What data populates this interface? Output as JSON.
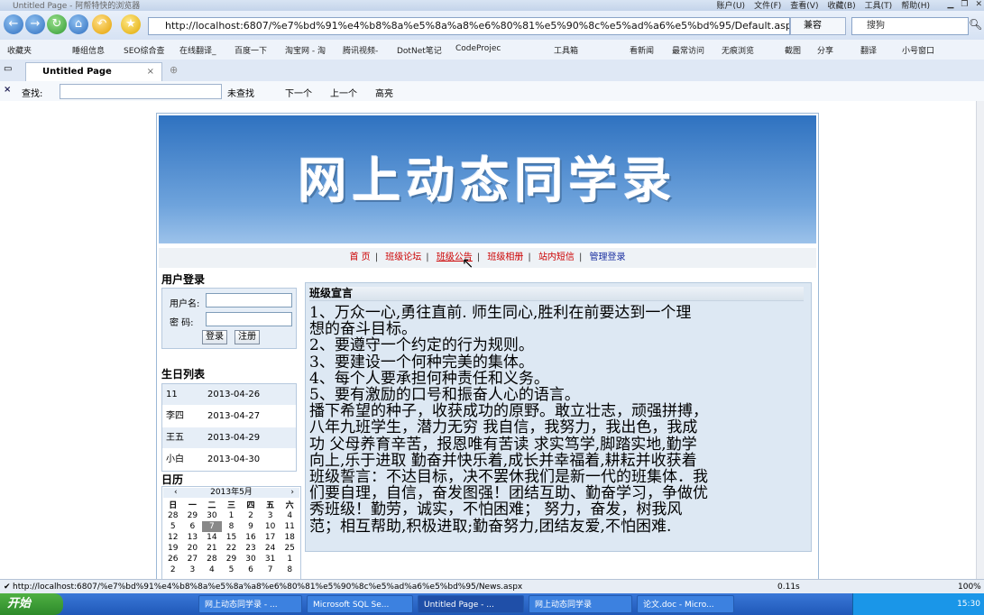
{
  "window": {
    "title": "Untitled Page - 阿帮特快的浏览器",
    "menu": [
      "账户(U)",
      "文件(F)",
      "查看(V)",
      "收藏(B)",
      "工具(T)",
      "帮助(H)"
    ]
  },
  "address": {
    "url": "http://localhost:6807/%e7%bd%91%e4%b8%8a%e5%8a%a8%e6%80%81%e5%90%8c%e5%ad%a6%e5%bd%95/Default.asp",
    "compat": "兼容",
    "search_placeholder": "搜狗"
  },
  "favorites": [
    "收藏夹",
    "睡组信息",
    "SEO综合查",
    "在线翻译_",
    "百度一下",
    "淘宝网 - 淘",
    "腾讯视频-",
    "DotNet笔记",
    "CodeProjec"
  ],
  "favorites_right": [
    "工具箱",
    "看新闻",
    "最常访问",
    "无痕浏览",
    "截图",
    "分享",
    "翻译",
    "小号窗口"
  ],
  "tab": {
    "label": "Untitled Page"
  },
  "find": {
    "label": "查找:",
    "not_found": "未查找",
    "next": "下一个",
    "prev": "上一个",
    "highlight": "高亮"
  },
  "site": {
    "banner_title": "网上动态同学录",
    "nav": [
      "首  页",
      "班级论坛",
      "班级公告",
      "班级相册",
      "站内短信",
      "管理登录"
    ],
    "login": {
      "title": "用户登录",
      "user_label": "用户名:",
      "pwd_label": "密  码:",
      "login_btn": "登录",
      "register_btn": "注册"
    },
    "birthday": {
      "title": "生日列表",
      "rows": [
        {
          "name": "11",
          "date": "2013-04-26"
        },
        {
          "name": "李四",
          "date": "2013-04-27"
        },
        {
          "name": "王五",
          "date": "2013-04-29"
        },
        {
          "name": "小白",
          "date": "2013-04-30"
        }
      ]
    },
    "calendar": {
      "title": "日历",
      "month": "2013年5月",
      "prev": "‹",
      "next": "›",
      "weekdays": [
        "日",
        "一",
        "二",
        "三",
        "四",
        "五",
        "六"
      ],
      "weeks": [
        [
          "28",
          "29",
          "30",
          "1",
          "2",
          "3",
          "4"
        ],
        [
          "5",
          "6",
          "7",
          "8",
          "9",
          "10",
          "11"
        ],
        [
          "12",
          "13",
          "14",
          "15",
          "16",
          "17",
          "18"
        ],
        [
          "19",
          "20",
          "21",
          "22",
          "23",
          "24",
          "25"
        ],
        [
          "26",
          "27",
          "28",
          "29",
          "30",
          "31",
          "1"
        ],
        [
          "2",
          "3",
          "4",
          "5",
          "6",
          "7",
          "8"
        ]
      ],
      "selected": "7"
    },
    "content": {
      "title": "班级宣言",
      "lines": [
        "1、万众一心,勇往直前. 师生同心,胜利在前要达到一个理",
        "想的奋斗目标。",
        "2、要遵守一个约定的行为规则。",
        "3、要建设一个何种完美的集体。",
        "4、每个人要承担何种责任和义务。",
        "5、要有激励的口号和振奋人心的语言。",
        "播下希望的种子，收获成功的原野。敢立壮志，顽强拼搏，",
        "八年九班学生，潜力无穷 我自信，我努力，我出色，我成",
        "功 父母养育辛苦，报恩唯有苦读 求实笃学,脚踏实地,勤学",
        "向上,乐于进取 勤奋并快乐着,成长并幸福着,耕耘并收获着",
        "班级誓言：不达目标，决不罢休我们是新一代的班集体．我",
        "们要自理，自信，奋发图强！团结互助、勤奋学习，争做优",
        "秀班级！勤劳，诚实，不怕困难；  努力，奋发，树我风",
        "范；相互帮助,积极进取;勤奋努力,团结友爱,不怕困难."
      ]
    }
  },
  "status": {
    "url": "http://localhost:6807/%e7%bd%91%e4%b8%8a%e5%8a%a8%e6%80%81%e5%90%8c%e5%ad%a6%e5%bd%95/News.aspx",
    "time": "0.11s",
    "zoom": "100%"
  },
  "taskbar": {
    "start": "开始",
    "tasks": [
      "网上动态同学录 - ...",
      "Microsoft SQL Se...",
      "Untitled Page - ...",
      "网上动态同学录",
      "论文.doc - Micro..."
    ],
    "clock": "15:30"
  }
}
